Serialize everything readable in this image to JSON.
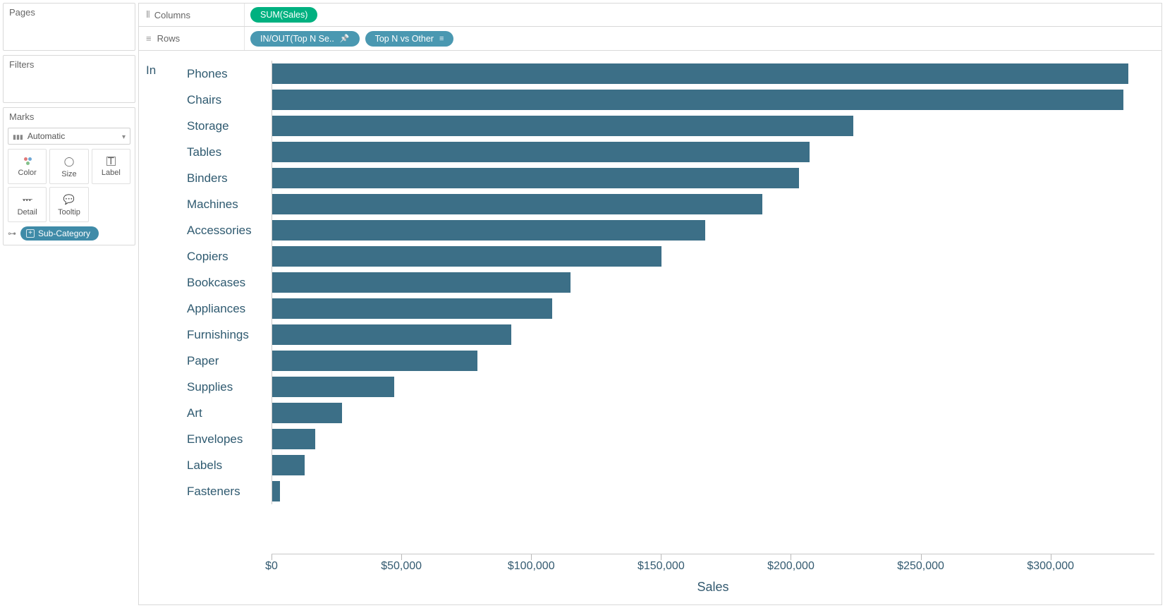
{
  "sidebar": {
    "pages_title": "Pages",
    "filters_title": "Filters",
    "marks_title": "Marks",
    "marks_mode": "Automatic",
    "mark_buttons": [
      {
        "id": "color",
        "label": "Color"
      },
      {
        "id": "size",
        "label": "Size"
      },
      {
        "id": "label",
        "label": "Label"
      },
      {
        "id": "detail",
        "label": "Detail"
      },
      {
        "id": "tooltip",
        "label": "Tooltip"
      }
    ],
    "subcategory_pill": "Sub-Category"
  },
  "shelves": {
    "columns_label": "Columns",
    "rows_label": "Rows",
    "columns_pills": [
      {
        "id": "sum-sales",
        "text": "SUM(Sales)",
        "color": "green"
      }
    ],
    "rows_pills": [
      {
        "id": "inout-set",
        "text": "IN/OUT(Top N Se..",
        "color": "blue",
        "pin": true
      },
      {
        "id": "topn-other",
        "text": "Top N vs Other",
        "color": "blue",
        "sort": true
      }
    ]
  },
  "chart": {
    "group_label": "In",
    "axis_title": "Sales"
  },
  "chart_data": {
    "type": "bar",
    "orientation": "horizontal",
    "xlabel": "Sales",
    "ylabel": "",
    "xlim": [
      0,
      340000
    ],
    "tick_step": 50000,
    "tick_labels": [
      "$0",
      "$50,000",
      "$100,000",
      "$150,000",
      "$200,000",
      "$250,000",
      "$300,000"
    ],
    "categories": [
      "Phones",
      "Chairs",
      "Storage",
      "Tables",
      "Binders",
      "Machines",
      "Accessories",
      "Copiers",
      "Bookcases",
      "Appliances",
      "Furnishings",
      "Paper",
      "Supplies",
      "Art",
      "Envelopes",
      "Labels",
      "Fasteners"
    ],
    "values": [
      330000,
      328000,
      224000,
      207000,
      203000,
      189000,
      167000,
      150000,
      115000,
      108000,
      92000,
      79000,
      47000,
      27000,
      16500,
      12500,
      3000
    ],
    "bar_color": "#3c6f87"
  }
}
